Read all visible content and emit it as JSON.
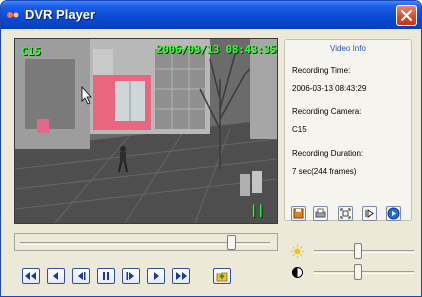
{
  "window": {
    "title": "DVR Player"
  },
  "video": {
    "camera_label": "C15",
    "timestamp_overlay": "2006/03/13 08:43:35",
    "status_mark": "||"
  },
  "info_panel": {
    "title": "Video Info",
    "recording_time_label": "Recording Time:",
    "recording_time_value": "2006-03-13 08:43:29",
    "recording_camera_label": "Recording Camera:",
    "recording_camera_value": "C15",
    "recording_duration_label": "Recording Duration:",
    "recording_duration_value": "7 sec(244 frames)"
  },
  "timeline": {
    "position_fraction": 0.86
  },
  "adjustments": {
    "brightness_fraction": 0.43,
    "contrast_fraction": 0.43
  },
  "colors": {
    "accent": "#2b52c9",
    "osd": "#32ff32",
    "titlebar": "#0a4cd8"
  },
  "toolbar_icons": [
    "save-icon",
    "print-icon",
    "fit-icon",
    "step-icon",
    "play-circle-icon"
  ],
  "transport_icons": [
    "first-frame-icon",
    "step-back-icon",
    "play-reverse-icon",
    "pause-icon",
    "play-forward-icon",
    "step-forward-icon",
    "last-frame-icon",
    "open-folder-icon"
  ]
}
